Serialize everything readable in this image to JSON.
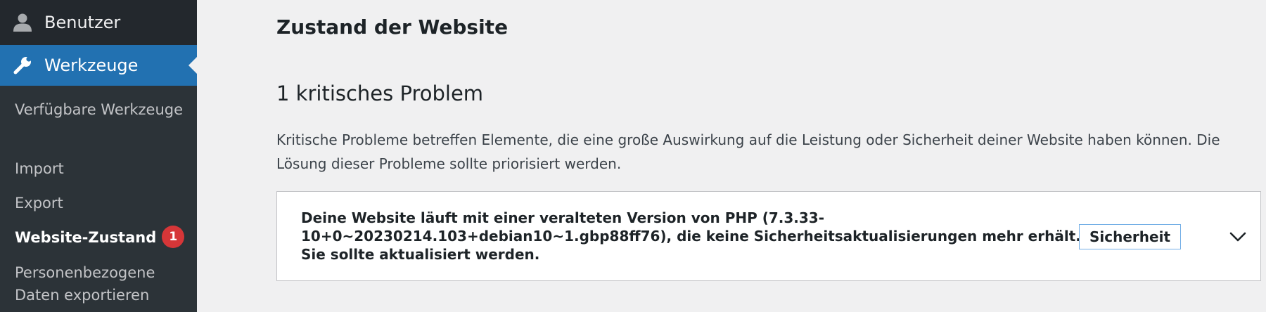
{
  "sidebar": {
    "menu": [
      {
        "label": "Benutzer",
        "icon": "user-icon"
      },
      {
        "label": "Werkzeuge",
        "icon": "wrench-icon"
      }
    ],
    "submenu": [
      {
        "label": "Verfügbare Werkzeuge"
      },
      {
        "label": "Import"
      },
      {
        "label": "Export"
      },
      {
        "label": "Website-Zustand",
        "badge": "1"
      },
      {
        "label": "Personenbezogene Daten exportieren"
      }
    ]
  },
  "main": {
    "page_title": "Zustand der Website",
    "section_heading": "1 kritisches Problem",
    "section_description": "Kritische Probleme betreffen Elemente, die eine große Auswirkung auf die Leistung oder Sicherheit deiner Website haben können. Die Lösung dieser Probleme sollte priorisiert werden.",
    "issue": {
      "text": "Deine Website läuft mit einer veralteten Version von PHP (7.3.33-10+0~20230214.103+debian10~1.gbp88ff76), die keine Sicherheitsaktualisierungen mehr erhält. Sie sollte aktualisiert werden.",
      "tag": "Sicherheit",
      "toggle_icon": "chevron-down-icon"
    }
  },
  "colors": {
    "sidebar_bg": "#2c3338",
    "active_menu": "#2271b1",
    "badge": "#d63638",
    "page_bg": "#f0f0f1",
    "tag_border": "#72aee6"
  }
}
